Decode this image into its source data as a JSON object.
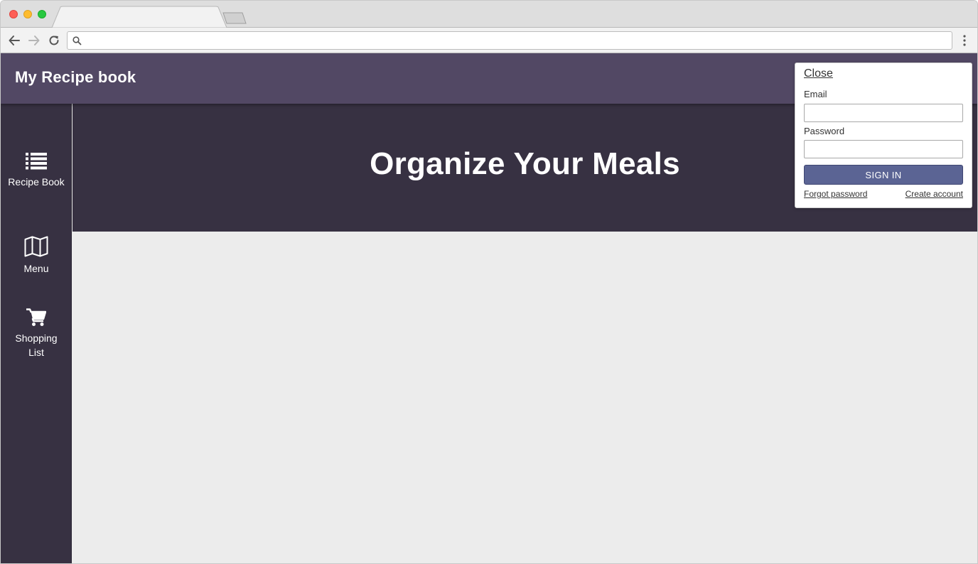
{
  "browser": {
    "tab_title": "",
    "address": "",
    "icons": {
      "back": "arrow-left-icon",
      "forward": "arrow-right-icon",
      "reload": "reload-icon",
      "search": "search-icon",
      "menu": "kebab-menu-icon"
    }
  },
  "app": {
    "title": "My Recipe book",
    "header_color": "#524864",
    "sidebar_color": "#373142"
  },
  "sidebar": {
    "items": [
      {
        "label": "Recipe Book",
        "icon": "list-icon"
      },
      {
        "label": "Menu",
        "icon": "map-icon"
      },
      {
        "label": "Shopping List",
        "icon": "cart-icon"
      }
    ]
  },
  "hero": {
    "title": "Organize Your Meals"
  },
  "signin": {
    "close_label": "Close",
    "email_label": "Email",
    "email_value": "",
    "password_label": "Password",
    "password_value": "",
    "submit_label": "SIGN IN",
    "forgot_label": "Forgot password",
    "create_label": "Create account",
    "button_color": "#5b6494"
  }
}
